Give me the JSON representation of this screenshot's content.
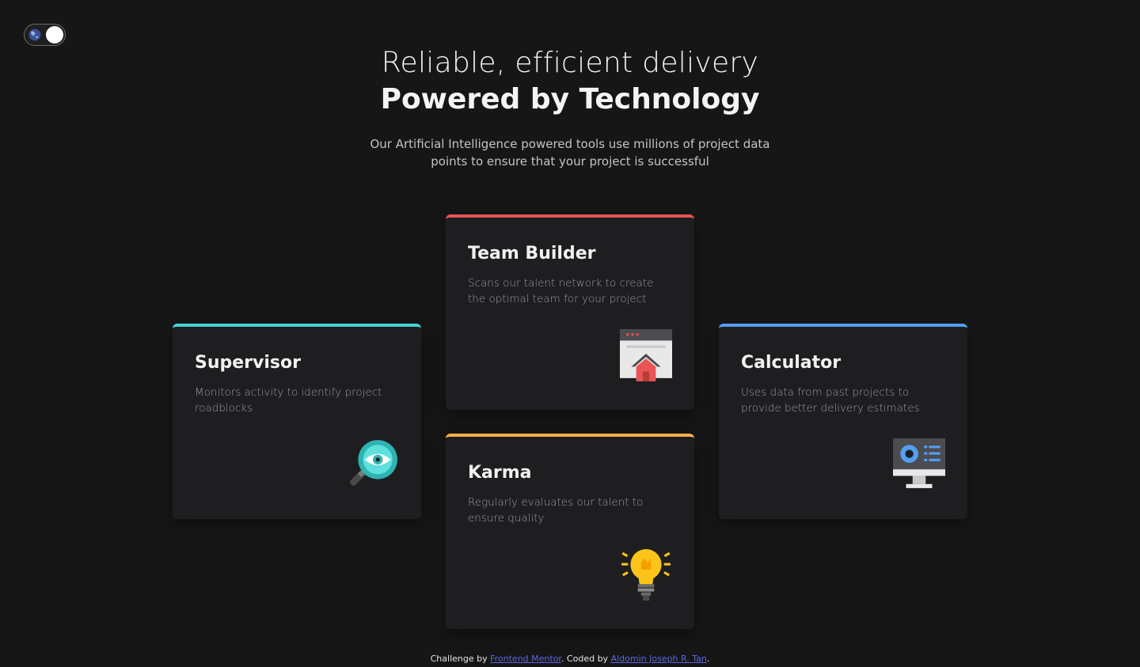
{
  "header": {
    "line1": "Reliable, efficient delivery",
    "line2": "Powered by Technology",
    "subtitle": "Our Artificial Intelligence powered tools use millions of project data points to ensure that your project is successful"
  },
  "toggle": {
    "icon": "globe-icon",
    "state": "on"
  },
  "cards": {
    "supervisor": {
      "title": "Supervisor",
      "desc": "Monitors activity to identify project roadblocks",
      "icon": "magnifier-eye-icon",
      "accent": "#44d3d2"
    },
    "team_builder": {
      "title": "Team Builder",
      "desc": "Scans our talent network to create the optimal team for your project",
      "icon": "browser-house-icon",
      "accent": "#ea5454"
    },
    "karma": {
      "title": "Karma",
      "desc": "Regularly evaluates our talent to ensure quality",
      "icon": "lightbulb-icon",
      "accent": "#fcaf4a"
    },
    "calculator": {
      "title": "Calculator",
      "desc": "Uses data from past projects to provide better delivery estimates",
      "icon": "monitor-chart-icon",
      "accent": "#549ef2"
    }
  },
  "footer": {
    "prefix": "Challenge by ",
    "link1": "Frontend Mentor",
    "middle": ". Coded by ",
    "link2": "Aldomin Joseph R. Tan",
    "suffix": "."
  }
}
